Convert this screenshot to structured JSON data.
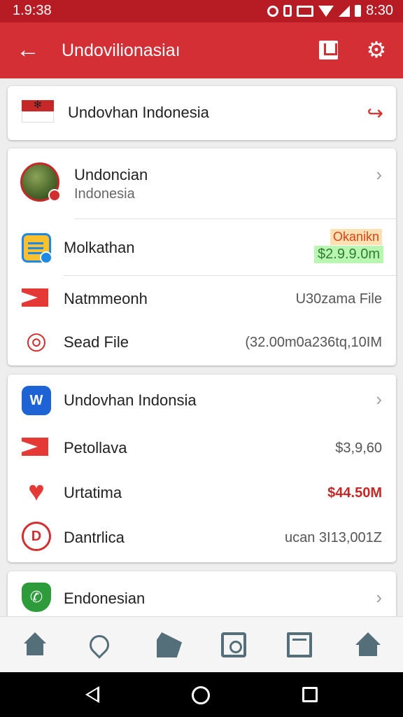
{
  "status_bar": {
    "time": "1.9:38",
    "clock": "8:30"
  },
  "app_bar": {
    "title": "Undovilionasiaı"
  },
  "card_top": {
    "title": "Undovhan Indonesia"
  },
  "card_account": {
    "profile": {
      "name": "Undoncian",
      "subtitle": "Indonesia"
    },
    "rows": [
      {
        "label": "Molkathan",
        "badge_orange": "Okanikn",
        "badge_green": "$2.9.9.0m"
      },
      {
        "label": "Natmmeonh",
        "value": "U30zama File"
      },
      {
        "label": "Sead File",
        "value": "(32.00m0a236tq,10IM"
      }
    ]
  },
  "card_list": {
    "header": "Undovhan Indonsia",
    "rows": [
      {
        "label": "Petollava",
        "value": "$3,9,60"
      },
      {
        "label": "Urtatima",
        "value": "$44.50M"
      },
      {
        "label": "Dantrlica",
        "value": "ucan 3I13,001Z"
      }
    ]
  },
  "card_bottom": {
    "label": "Endonesian"
  },
  "colors": {
    "primary": "#d32f34",
    "status_bar": "#b71c25",
    "danger_value": "#c62828"
  }
}
